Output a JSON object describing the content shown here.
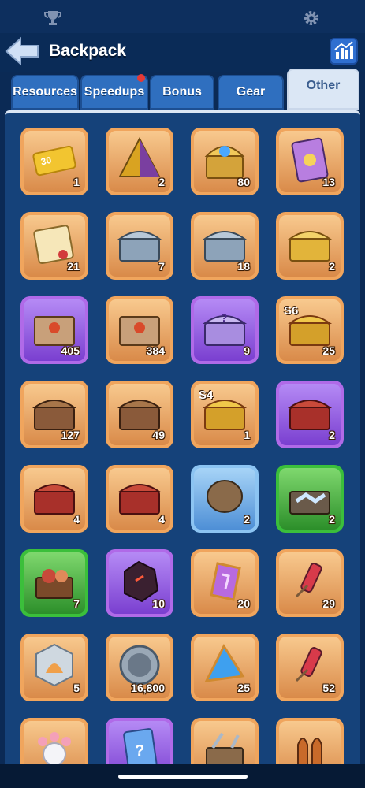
{
  "header": {
    "title": "Backpack"
  },
  "icons": {
    "trophy": "trophy-icon",
    "settings": "gear-icon",
    "back": "back-arrow-icon",
    "stats": "stats-chart-icon"
  },
  "tabs": [
    {
      "label": "Resources",
      "active": false,
      "dot": false
    },
    {
      "label": "Speedups",
      "active": false,
      "dot": true
    },
    {
      "label": "Bonus",
      "active": false,
      "dot": false
    },
    {
      "label": "Gear",
      "active": false,
      "dot": false
    },
    {
      "label": "Other",
      "active": true,
      "dot": false
    }
  ],
  "items": [
    {
      "icon": "ticket-icon",
      "frame": "orange",
      "count": "1",
      "badge": ""
    },
    {
      "icon": "pyramid-icon",
      "frame": "orange",
      "count": "2",
      "badge": ""
    },
    {
      "icon": "treasure-chest-icon",
      "frame": "orange",
      "count": "80",
      "badge": ""
    },
    {
      "icon": "card-icon",
      "frame": "orange",
      "count": "13",
      "badge": ""
    },
    {
      "icon": "scroll-icon",
      "frame": "orange",
      "count": "21",
      "badge": ""
    },
    {
      "icon": "silver-chest-icon",
      "frame": "orange",
      "count": "7",
      "badge": ""
    },
    {
      "icon": "silver-chest-icon",
      "frame": "orange",
      "count": "18",
      "badge": ""
    },
    {
      "icon": "gold-chest-icon",
      "frame": "orange",
      "count": "2",
      "badge": ""
    },
    {
      "icon": "crate-icon",
      "frame": "purple",
      "count": "405",
      "badge": ""
    },
    {
      "icon": "crate-icon",
      "frame": "orange",
      "count": "384",
      "badge": ""
    },
    {
      "icon": "mystery-chest-icon",
      "frame": "purple",
      "count": "9",
      "badge": ""
    },
    {
      "icon": "season-chest-icon",
      "frame": "orange",
      "count": "25",
      "badge": "S6"
    },
    {
      "icon": "chest-icon",
      "frame": "orange",
      "count": "127",
      "badge": ""
    },
    {
      "icon": "chest-icon",
      "frame": "orange",
      "count": "49",
      "badge": ""
    },
    {
      "icon": "season-chest-icon",
      "frame": "orange",
      "count": "1",
      "badge": "S4"
    },
    {
      "icon": "red-chest-icon",
      "frame": "purple",
      "count": "2",
      "badge": ""
    },
    {
      "icon": "red-chest-icon",
      "frame": "orange",
      "count": "4",
      "badge": ""
    },
    {
      "icon": "red-chest-icon",
      "frame": "orange",
      "count": "4",
      "badge": ""
    },
    {
      "icon": "barrel-chest-icon",
      "frame": "blue",
      "count": "2",
      "badge": ""
    },
    {
      "icon": "upgrade-chest-icon",
      "frame": "green",
      "count": "2",
      "badge": ""
    },
    {
      "icon": "food-chest-icon",
      "frame": "green",
      "count": "7",
      "badge": ""
    },
    {
      "icon": "dark-ore-icon",
      "frame": "purple",
      "count": "10",
      "badge": ""
    },
    {
      "icon": "purple-gem-icon",
      "frame": "orange",
      "count": "20",
      "badge": ""
    },
    {
      "icon": "firework-icon",
      "frame": "orange",
      "count": "29",
      "badge": ""
    },
    {
      "icon": "shell-coin-icon",
      "frame": "orange",
      "count": "5",
      "badge": ""
    },
    {
      "icon": "silver-coin-icon",
      "frame": "orange",
      "count": "16,800",
      "badge": ""
    },
    {
      "icon": "blue-crystal-icon",
      "frame": "orange",
      "count": "25",
      "badge": ""
    },
    {
      "icon": "firework-icon",
      "frame": "orange",
      "count": "52",
      "badge": ""
    },
    {
      "icon": "paw-icon",
      "frame": "orange",
      "count": "",
      "badge": ""
    },
    {
      "icon": "mystery-card-icon",
      "frame": "purple",
      "count": "",
      "badge": ""
    },
    {
      "icon": "tools-box-icon",
      "frame": "orange",
      "count": "",
      "badge": ""
    },
    {
      "icon": "rocket-icon",
      "frame": "orange",
      "count": "",
      "badge": ""
    }
  ]
}
